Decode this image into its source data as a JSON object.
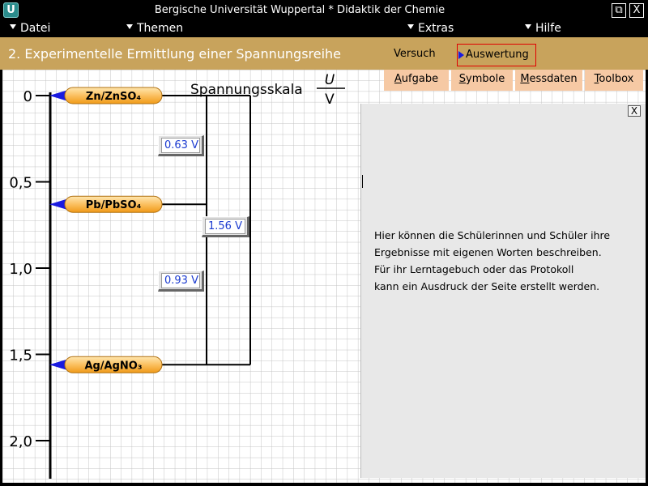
{
  "window": {
    "title": "Bergische Universität Wuppertal   *   Didaktik der Chemie",
    "logo_letter": "U",
    "restore_symbol": "⧉",
    "close_symbol": "X"
  },
  "menu": {
    "items": [
      "Datei",
      "Themen",
      "Extras",
      "Hilfe"
    ]
  },
  "header": {
    "page_title": "2. Experimentelle Ermittlung einer Spannungsreihe",
    "tabs": [
      {
        "label": "Versuch",
        "active": false
      },
      {
        "label": "Auswertung",
        "active": true
      }
    ]
  },
  "subbuttons": [
    {
      "first": "A",
      "rest": "ufgabe"
    },
    {
      "first": "S",
      "rest": "ymbole"
    },
    {
      "first": "M",
      "rest": "essdaten"
    },
    {
      "first": "T",
      "rest": "oolbox"
    }
  ],
  "scale": {
    "title": "Spannungsskala",
    "unit_num": "U",
    "unit_den": "V",
    "ticks": [
      "0",
      "0,5",
      "1,0",
      "1,5",
      "2,0"
    ],
    "electrodes": [
      {
        "label": "Zn/ZnSO₄",
        "value": 0
      },
      {
        "label": "Pb/PbSO₄",
        "value": 0.63
      },
      {
        "label": "Ag/AgNO₃",
        "value": 1.56
      }
    ],
    "voltages": [
      {
        "text": "0.63 V"
      },
      {
        "text": "1.56 V"
      },
      {
        "text": "0.93 V"
      }
    ]
  },
  "panel": {
    "close_label": "X",
    "lines": [
      "Hier können die Schülerinnen und Schüler ihre",
      "Ergebnisse mit eigenen Worten beschreiben.",
      "Für ihr Lerntagebuch oder das Protokoll",
      "kann ein Ausdruck der Seite erstellt werden."
    ]
  },
  "colors": {
    "header": "#c8a35c",
    "subbutton": "#f6c9a4",
    "pill_top": "#ffe3a0",
    "pill_bottom": "#f4a020",
    "marker": "#1a1ae0",
    "voltage_text": "#1a3ad0"
  }
}
